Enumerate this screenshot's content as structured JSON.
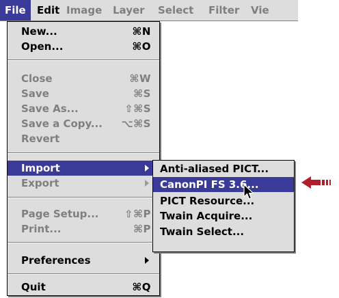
{
  "menubar": {
    "items": [
      "File",
      "Edit",
      "Image",
      "Layer",
      "Select",
      "Filter",
      "Vie"
    ]
  },
  "file_menu": {
    "new": {
      "label": "New...",
      "shortcut": "⌘N"
    },
    "open": {
      "label": "Open...",
      "shortcut": "⌘O"
    },
    "close": {
      "label": "Close",
      "shortcut": "⌘W"
    },
    "save": {
      "label": "Save",
      "shortcut": "⌘S"
    },
    "save_as": {
      "label": "Save As...",
      "shortcut": "⇧⌘S"
    },
    "save_copy": {
      "label": "Save a Copy...",
      "shortcut": "⌥⌘S"
    },
    "revert": {
      "label": "Revert"
    },
    "import": {
      "label": "Import"
    },
    "export": {
      "label": "Export"
    },
    "page_setup": {
      "label": "Page Setup...",
      "shortcut": "⇧⌘P"
    },
    "print": {
      "label": "Print...",
      "shortcut": "⌘P"
    },
    "preferences": {
      "label": "Preferences"
    },
    "quit": {
      "label": "Quit",
      "shortcut": "⌘Q"
    }
  },
  "import_submenu": {
    "items": [
      "Anti-aliased PICT...",
      "CanonPI FS 3.6...",
      "PICT Resource...",
      "Twain Acquire...",
      "Twain Select..."
    ]
  },
  "colors": {
    "highlight": "#3a3a98",
    "menu_bg": "#dddddd",
    "disabled_text": "#7f7f7f",
    "callout_arrow": "#b01e2a"
  },
  "icons": [
    "submenu-arrow-icon",
    "pointer-cursor-icon",
    "red-callout-arrow-icon"
  ]
}
